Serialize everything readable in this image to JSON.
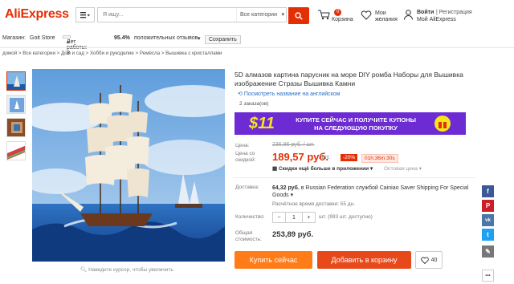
{
  "header": {
    "logo": "AliExpress",
    "search_placeholder": "Я ищу...",
    "search_category": "Все категории",
    "cart_count": "0",
    "cart_label": "Корзина",
    "wish_line1": "Мои",
    "wish_line2": "желания",
    "login": "Войти",
    "register": "Регистрация",
    "my_ali": "Мой AliExpress"
  },
  "store": {
    "label": "Магазин:",
    "name": "Goit Store",
    "years": "Лет работы: 3",
    "rating": "95.4%",
    "rating_text": "положительных отзывов",
    "save": "Сохранить"
  },
  "breadcrumb": "домой > Все категории > Дом и сад > Хобби и рукоделие > Ремёсла > Вышивка с кристаллами",
  "product": {
    "title": "5D алмазов картина парусник на море DIY ромба Наборы для Вышивка изображение Стразы Вышивка Камни",
    "translate": "Посмотреть название на английском",
    "orders": "2 заказа(ов)",
    "promo_amount": "$11",
    "promo_text": "КУПИТЕ СЕЙЧАС И ПОЛУЧИТЕ КУПОНЫ НА СЛЕДУЮЩУЮ ПОКУПКУ",
    "price_label": "Цена:",
    "old_price": "236,96 руб. / шт.",
    "discount_label": "Цена со скидкой:",
    "price": "189,57 руб.",
    "per_unit": "/ шт.",
    "discount": "-20%",
    "timer": "01h:36m:30s",
    "app_discount": "Скидки ещё больше в приложении",
    "wholesale": "Оптовая цена",
    "shipping_label": "Доставка:",
    "shipping_price": "64,32 руб.",
    "shipping_text": "в Russian Federation службой Cainiao Saver Shipping For Special Goods",
    "delivery_time": "Расчётное время доставки: 55 дн.",
    "qty_label": "Количество:",
    "qty_minus": "−",
    "qty_value": "1",
    "qty_plus": "+",
    "qty_unit": "шт. (993 шт. доступно)",
    "total_label": "Общая стоимость:",
    "total": "253,89 руб.",
    "buy_now": "Купить сейчас",
    "add_to_cart": "Добавить в корзину",
    "wish_count": "40",
    "zoom_hint": "Наведите курсор, чтобы увеличить"
  },
  "social": [
    "f",
    "P",
    "vk",
    "t",
    "✎",
    "•••"
  ],
  "colors": {
    "brand": "#e62e04",
    "buy": "#ff7c18",
    "cart": "#e8491b",
    "promo": "#6d2bd4"
  }
}
